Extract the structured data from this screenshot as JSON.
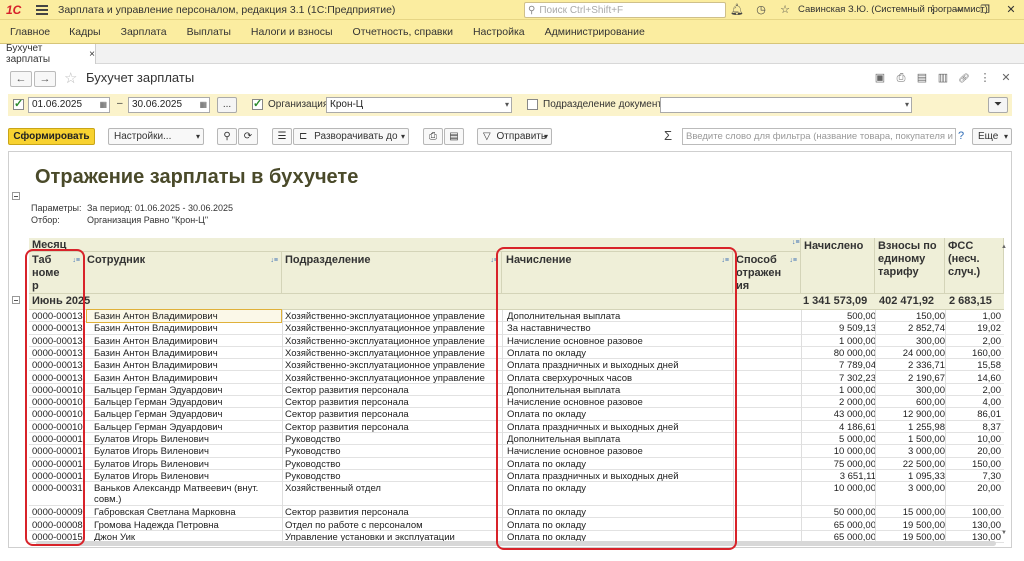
{
  "app": {
    "logo": "1С",
    "title": "Зарплата и управление персоналом, редакция 3.1  (1С:Предприятие)",
    "search_placeholder": "Поиск Ctrl+Shift+F",
    "user": "Савинская З.Ю. (Системный программист)"
  },
  "menu": [
    "Главное",
    "Кадры",
    "Зарплата",
    "Выплаты",
    "Налоги и взносы",
    "Отчетность, справки",
    "Настройка",
    "Администрирование"
  ],
  "tab": {
    "label": "Бухучет зарплаты",
    "close": "×"
  },
  "form": {
    "title": "Бухучет зарплаты",
    "back": "←",
    "forward": "→"
  },
  "params": {
    "date_from": "01.06.2025",
    "dash": "–",
    "date_to": "30.06.2025",
    "ellipsis": "...",
    "org_label": "Организация:",
    "org_value": "Крон-Ц",
    "dept_label": "Подразделение документа:",
    "dept_value": ""
  },
  "toolbar": {
    "generate": "Сформировать",
    "settings": "Настройки...",
    "expand": "Разворачивать до",
    "send": "Отправить",
    "filter_placeholder": "Введите слово для фильтра (название товара, покупателя и пр.)",
    "help": "?",
    "more": "Еще"
  },
  "report": {
    "title": "Отражение зарплаты в бухучете",
    "params_label": "Параметры:",
    "params_value": "За период: 01.06.2025 - 30.06.2025",
    "filter_label": "Отбор:",
    "filter_value": "Организация Равно \"Крон-Ц\"",
    "header": {
      "month": "Месяц",
      "tabnum": "Таб\nноме\nр",
      "employee": "Сотрудник",
      "department": "Подразделение",
      "accrual": "Начисление",
      "method": "Способ\nотражен\nия",
      "accrued": "Начислено",
      "contrib": "Взносы по\nединому\nтарифу",
      "fss": "ФСС\n(несч.\nслуч.)"
    },
    "group": {
      "label": "Июнь 2025",
      "accrued": "1 341 573,09",
      "contrib": "402 471,92",
      "fss": "2 683,15"
    },
    "rows": [
      {
        "tab": "0000-00013",
        "emp": "Базин Антон Владимирович",
        "dept": "Хозяйственно-эксплуатационное управление",
        "acc": "Дополнительная выплата",
        "sum": "500,00",
        "contrib": "150,00",
        "fss": "1,00"
      },
      {
        "tab": "0000-00013",
        "emp": "Базин Антон Владимирович",
        "dept": "Хозяйственно-эксплуатационное управление",
        "acc": "За наставничество",
        "sum": "9 509,13",
        "contrib": "2 852,74",
        "fss": "19,02"
      },
      {
        "tab": "0000-00013",
        "emp": "Базин Антон Владимирович",
        "dept": "Хозяйственно-эксплуатационное управление",
        "acc": "Начисление основное разовое",
        "sum": "1 000,00",
        "contrib": "300,00",
        "fss": "2,00"
      },
      {
        "tab": "0000-00013",
        "emp": "Базин Антон Владимирович",
        "dept": "Хозяйственно-эксплуатационное управление",
        "acc": "Оплата по окладу",
        "sum": "80 000,00",
        "contrib": "24 000,00",
        "fss": "160,00"
      },
      {
        "tab": "0000-00013",
        "emp": "Базин Антон Владимирович",
        "dept": "Хозяйственно-эксплуатационное управление",
        "acc": "Оплата праздничных и выходных дней",
        "sum": "7 789,04",
        "contrib": "2 336,71",
        "fss": "15,58"
      },
      {
        "tab": "0000-00013",
        "emp": "Базин Антон Владимирович",
        "dept": "Хозяйственно-эксплуатационное управление",
        "acc": "Оплата сверхурочных часов",
        "sum": "7 302,23",
        "contrib": "2 190,67",
        "fss": "14,60"
      },
      {
        "tab": "0000-00010",
        "emp": "Бальцер Герман Эдуардович",
        "dept": "Сектор развития персонала",
        "acc": "Дополнительная выплата",
        "sum": "1 000,00",
        "contrib": "300,00",
        "fss": "2,00"
      },
      {
        "tab": "0000-00010",
        "emp": "Бальцер Герман Эдуардович",
        "dept": "Сектор развития персонала",
        "acc": "Начисление основное разовое",
        "sum": "2 000,00",
        "contrib": "600,00",
        "fss": "4,00"
      },
      {
        "tab": "0000-00010",
        "emp": "Бальцер Герман Эдуардович",
        "dept": "Сектор развития персонала",
        "acc": "Оплата по окладу",
        "sum": "43 000,00",
        "contrib": "12 900,00",
        "fss": "86,01"
      },
      {
        "tab": "0000-00010",
        "emp": "Бальцер Герман Эдуардович",
        "dept": "Сектор развития персонала",
        "acc": "Оплата праздничных и выходных дней",
        "sum": "4 186,61",
        "contrib": "1 255,98",
        "fss": "8,37"
      },
      {
        "tab": "0000-00001",
        "emp": "Булатов Игорь Виленович",
        "dept": "Руководство",
        "acc": "Дополнительная выплата",
        "sum": "5 000,00",
        "contrib": "1 500,00",
        "fss": "10,00"
      },
      {
        "tab": "0000-00001",
        "emp": "Булатов Игорь Виленович",
        "dept": "Руководство",
        "acc": "Начисление основное разовое",
        "sum": "10 000,00",
        "contrib": "3 000,00",
        "fss": "20,00"
      },
      {
        "tab": "0000-00001",
        "emp": "Булатов Игорь Виленович",
        "dept": "Руководство",
        "acc": "Оплата по окладу",
        "sum": "75 000,00",
        "contrib": "22 500,00",
        "fss": "150,00"
      },
      {
        "tab": "0000-00001",
        "emp": "Булатов Игорь Виленович",
        "dept": "Руководство",
        "acc": "Оплата праздничных и выходных дней",
        "sum": "3 651,11",
        "contrib": "1 095,33",
        "fss": "7,30"
      },
      {
        "tab": "0000-00031",
        "emp": "Ваньков Александр Матвеевич (внут. совм.)",
        "dept": "Хозяйственный отдел",
        "acc": "Оплата по окладу",
        "sum": "10 000,00",
        "contrib": "3 000,00",
        "fss": "20,00"
      },
      {
        "tab": "0000-00009",
        "emp": "Габровская Светлана Марковна",
        "dept": "Сектор развития персонала",
        "acc": "Оплата по окладу",
        "sum": "50 000,00",
        "contrib": "15 000,00",
        "fss": "100,00"
      },
      {
        "tab": "0000-00008",
        "emp": "Громова Надежда Петровна",
        "dept": "Отдел по работе с персоналом",
        "acc": "Оплата по окладу",
        "sum": "65 000,00",
        "contrib": "19 500,00",
        "fss": "130,00"
      },
      {
        "tab": "0000-00015",
        "emp": "Джон Уик",
        "dept": "Управление установки и эксплуатации",
        "acc": "Оплата по окладу",
        "sum": "65 000,00",
        "contrib": "19 500,00",
        "fss": "130,00"
      }
    ]
  }
}
